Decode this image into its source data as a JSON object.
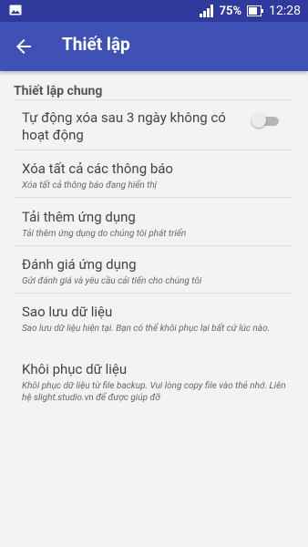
{
  "statusbar": {
    "battery": "75%",
    "time": "12:28"
  },
  "appbar": {
    "title": "Thiết lập"
  },
  "settings": {
    "section_title": "Thiết lập chung",
    "auto_delete": {
      "title": "Tự động xóa sau 3 ngày không có hoạt động",
      "enabled": false
    },
    "clear_notifications": {
      "title": "Xóa tất cả các thông báo",
      "summary": "Xóa tất cả thông báo đang hiển thị"
    },
    "more_apps": {
      "title": "Tải thêm ứng dụng",
      "summary": "Tải thêm ứng dụng do chúng tôi phát triển"
    },
    "rate_app": {
      "title": "Đánh giá ứng dụng",
      "summary": "Gửi đánh giá và yêu cầu cải tiến cho chúng tôi"
    },
    "backup": {
      "title": "Sao lưu dữ liệu",
      "summary": "Sao lưu dữ liệu hiện tại. Bạn có thể khôi phục lại bất cứ lúc nào."
    },
    "restore": {
      "title": "Khôi phục dữ liệu",
      "summary": "Khôi phục dữ liệu từ file backup. Vui lòng copy file vào thẻ nhớ. Liên hệ slight.studio.vn để được giúp đỡ"
    }
  }
}
